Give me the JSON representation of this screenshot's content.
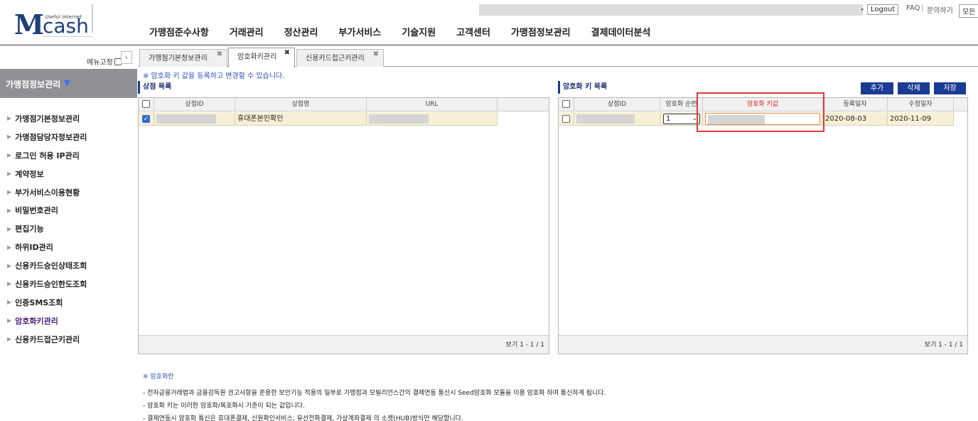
{
  "brand": {
    "tagline": "Useful Internet",
    "logo_m": "M",
    "logo_rest": "cash"
  },
  "header": {
    "logout_label": "Logout",
    "faq_label": "FAQ",
    "inquiry_label": "문의하기",
    "all_label": "모든 "
  },
  "nav": {
    "items": [
      "가맹점준수사항",
      "거래관리",
      "정산관리",
      "부가서비스",
      "기술지원",
      "고객센터",
      "가맹점정보관리",
      "결제데이터분석"
    ]
  },
  "sidebar": {
    "fix_label": "메뉴고정",
    "collapse_icon": "‹",
    "section_title": "가맹점정보관리",
    "section_icon": "▼",
    "items": [
      {
        "label": "가맹점기본정보관리"
      },
      {
        "label": "가맹점담당자정보관리"
      },
      {
        "label": "로그인 허용 IP관리"
      },
      {
        "label": "계약정보"
      },
      {
        "label": "부가서비스이용현황"
      },
      {
        "label": "비밀번호관리"
      },
      {
        "label": "편집기능"
      },
      {
        "label": "하위ID관리"
      },
      {
        "label": "신용카드승인상태조회"
      },
      {
        "label": "신용카드승인한도조회"
      },
      {
        "label": "인증SMS조회"
      },
      {
        "label": "암호화키관리"
      },
      {
        "label": "신용카드접근키관리"
      }
    ],
    "active_index": 11
  },
  "tabs": [
    {
      "label": "가맹점기본정보관리",
      "close": "✖"
    },
    {
      "label": "암호화키관리",
      "close": "✖"
    },
    {
      "label": "신용카드접근키관리",
      "close": "✖"
    }
  ],
  "notice": "※ 암호화 키 값을 등록하고 변경할 수 있습니다.",
  "store_panel": {
    "title": "상점 목록",
    "columns": [
      "상점ID",
      "상점명",
      "URL"
    ],
    "row": {
      "store_name": "휴대폰본인확인"
    },
    "footer": "보기 1 - 1 / 1"
  },
  "key_panel": {
    "title": "암호화 키 목록",
    "buttons": {
      "add": "추가",
      "delete": "삭제",
      "save": "저장"
    },
    "columns": [
      "상점ID",
      "암호화 순번",
      "암호화 키값",
      "등록일자",
      "수정일자"
    ],
    "row": {
      "seq": "1",
      "reg_date": "2020-08-03",
      "mod_date": "2020-11-09"
    },
    "footer": "보기 1 - 1 / 1"
  },
  "info": {
    "title": "※ 암호화란",
    "lines": [
      "- 전자금융거래법과 금융감독원 권고사항을 준용한 보안기능 적용의 일부로 가맹점과 모빌리언스간의 결제연동 통신시 Seed암호화 모듈을 이용 암호화 하여 통신하게 됩니다.",
      "- 암호화 키는 이러한 암호화/복호화시 기준이 되는 값입니다.",
      "- 결제연동시 암호화 통신은 휴대폰결제, 신원확인서비스, 유선전화결제, 가상계좌결제 의 소켓(HUB)방식만 해당합니다."
    ]
  },
  "colors": {
    "accent": "#1a3b94",
    "highlight": "#e53935",
    "row_selected": "#f7f0d7"
  }
}
